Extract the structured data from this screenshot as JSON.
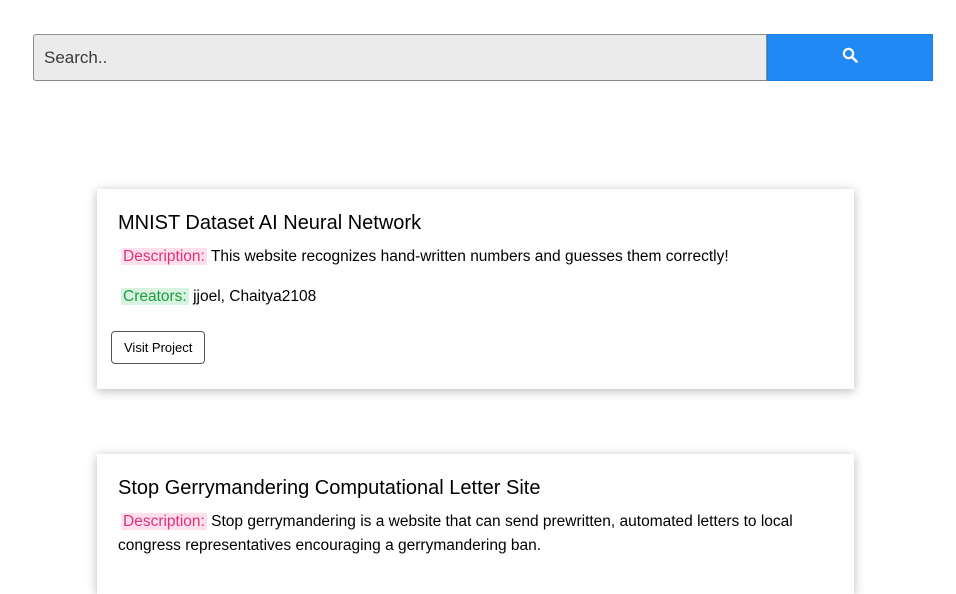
{
  "search": {
    "placeholder": "Search..",
    "button_icon": "search-icon",
    "button_color": "#2189f3"
  },
  "projects": [
    {
      "title": "MNIST Dataset AI Neural Network",
      "description_label": "Description:",
      "description": "This website recognizes hand-written numbers and guesses them correctly!",
      "creators_label": "Creators:",
      "creators": "jjoel, Chaitya2108",
      "visit_label": "Visit Project"
    },
    {
      "title": "Stop Gerrymandering Computational Letter Site",
      "description_label": "Description:",
      "description": "Stop gerrymandering is a website that can send prewritten, automated letters to local congress representatives encouraging a gerrymandering ban."
    }
  ],
  "colors": {
    "description_label": "#e0307b",
    "description_highlight": "#fde0ec",
    "creators_label": "#1f9a45",
    "creators_highlight": "#d8f3df"
  }
}
